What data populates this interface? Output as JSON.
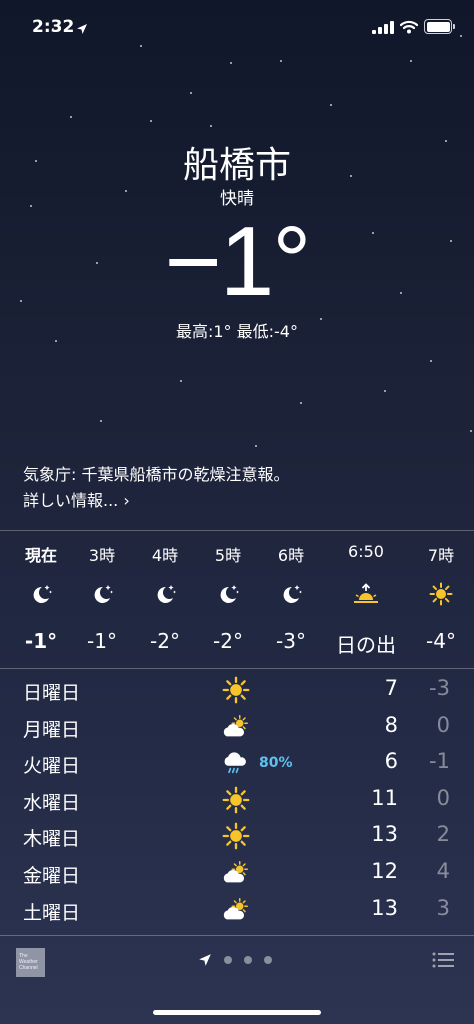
{
  "status_bar": {
    "time": "2:32"
  },
  "header": {
    "city": "船橋市",
    "condition": "快晴",
    "temperature": "−1°",
    "hi_lo": "最高:1° 最低:-4°"
  },
  "alert": {
    "line1": "気象庁: 千葉県船橋市の乾燥注意報。",
    "line2": "詳しい情報... ›"
  },
  "hourly": [
    {
      "label": "現在",
      "icon": "moon-stars-icon",
      "temp": "-1°",
      "bold": true
    },
    {
      "label": "3時",
      "icon": "moon-stars-icon",
      "temp": "-1°"
    },
    {
      "label": "4時",
      "icon": "moon-stars-icon",
      "temp": "-2°"
    },
    {
      "label": "5時",
      "icon": "moon-stars-icon",
      "temp": "-2°"
    },
    {
      "label": "6時",
      "icon": "moon-stars-icon",
      "temp": "-3°"
    },
    {
      "label": "6:50",
      "icon": "sunrise-icon",
      "temp": "日の出"
    },
    {
      "label": "7時",
      "icon": "sun-icon",
      "temp": "-4°"
    }
  ],
  "daily": [
    {
      "day": "日曜日",
      "icon": "sun-icon",
      "precip": "",
      "high": "7",
      "low": "-3"
    },
    {
      "day": "月曜日",
      "icon": "partly-cloudy-icon",
      "precip": "",
      "high": "8",
      "low": "0"
    },
    {
      "day": "火曜日",
      "icon": "rain-icon",
      "precip": "80%",
      "high": "6",
      "low": "-1"
    },
    {
      "day": "水曜日",
      "icon": "sun-icon",
      "precip": "",
      "high": "11",
      "low": "0"
    },
    {
      "day": "木曜日",
      "icon": "sun-icon",
      "precip": "",
      "high": "13",
      "low": "2"
    },
    {
      "day": "金曜日",
      "icon": "partly-cloudy-icon",
      "precip": "",
      "high": "12",
      "low": "4"
    },
    {
      "day": "土曜日",
      "icon": "partly-cloudy-icon",
      "precip": "",
      "high": "13",
      "low": "3"
    }
  ],
  "footer": {
    "logo_text": "The Weather Channel",
    "page_dots": 3
  },
  "colors": {
    "precip": "#5ec1ef",
    "sun": "#f7c52a",
    "background_top": "#10172a",
    "background_bottom": "#2c3452"
  }
}
